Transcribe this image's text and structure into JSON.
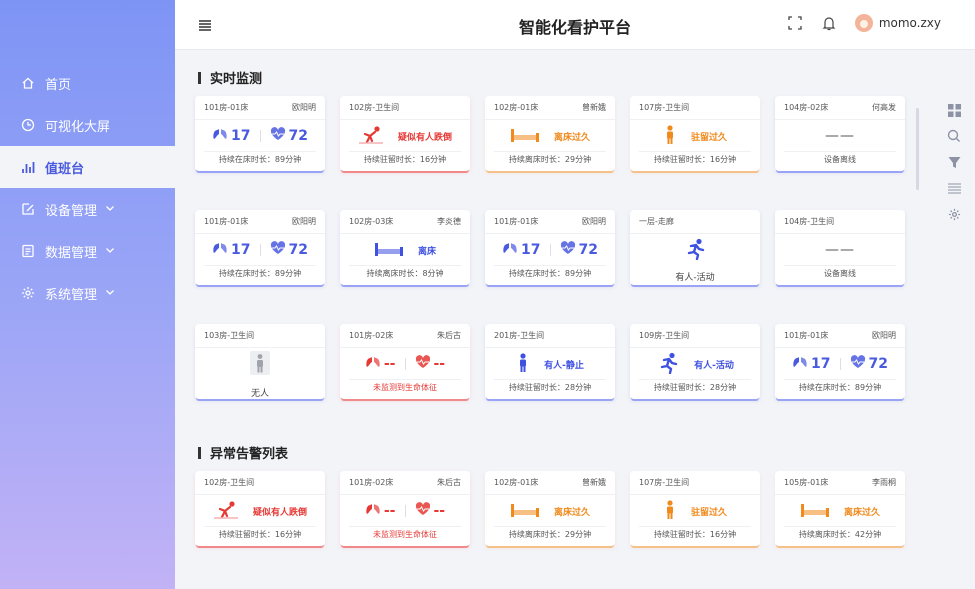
{
  "app": {
    "title": "智能化看护平台"
  },
  "user": {
    "name": "momo.zxy"
  },
  "sidebar": {
    "items": [
      {
        "label": "首页",
        "icon": "home-icon"
      },
      {
        "label": "可视化大屏",
        "icon": "clock-icon"
      },
      {
        "label": "值班台",
        "icon": "bar-chart-icon",
        "active": true
      },
      {
        "label": "设备管理",
        "icon": "edit-icon",
        "has_children": true
      },
      {
        "label": "数据管理",
        "icon": "document-icon",
        "has_children": true
      },
      {
        "label": "系统管理",
        "icon": "gear-icon",
        "has_children": true
      }
    ]
  },
  "sections": {
    "realtime": "实时监测",
    "alerts": "异常告警列表"
  },
  "colors": {
    "accent": "#4a5adf",
    "alert_red": "#e53935",
    "warn_orange": "#f08a1c",
    "sidebar_top": "#7e94f5",
    "sidebar_bottom": "#c2b2f6"
  },
  "realtime_cards": [
    {
      "location": "101房-01床",
      "person": "欧阳明",
      "type": "vitals",
      "lung": "17",
      "heart": "72",
      "footer": "持续在床时长：89分钟",
      "accent": "blue"
    },
    {
      "location": "102房-卫生间",
      "person": "",
      "type": "state",
      "icon": "fall-icon",
      "status": "疑似有人跌倒",
      "tone": "red",
      "footer": "持续驻留时长：16分钟",
      "accent": "red"
    },
    {
      "location": "102房-01床",
      "person": "曾新娥",
      "type": "state",
      "icon": "bed-icon",
      "status": "离床过久",
      "tone": "orange",
      "footer": "持续离床时长：29分钟",
      "accent": "orange"
    },
    {
      "location": "107房-卫生间",
      "person": "",
      "type": "state",
      "icon": "person-standing-icon",
      "status": "驻留过久",
      "tone": "orange",
      "footer": "持续驻留时长：16分钟",
      "accent": "orange"
    },
    {
      "location": "104房-02床",
      "person": "何高发",
      "type": "dash",
      "status": "——",
      "footer": "设备离线",
      "accent": "blue"
    },
    {
      "location": "101房-01床",
      "person": "欧阳明",
      "type": "vitals",
      "lung": "17",
      "heart": "72",
      "footer": "持续在床时长：89分钟",
      "accent": "blue"
    },
    {
      "location": "102房-03床",
      "person": "李炎德",
      "type": "state",
      "icon": "bed-icon",
      "status": "离床",
      "tone": "blue",
      "footer": "持续离床时长：8分钟",
      "accent": "blue"
    },
    {
      "location": "101房-01床",
      "person": "欧阳明",
      "type": "vitals",
      "lung": "17",
      "heart": "72",
      "footer": "持续在床时长：89分钟",
      "accent": "blue"
    },
    {
      "location": "一层-走廊",
      "person": "",
      "type": "big",
      "icon": "running-icon",
      "status": "有人-活动",
      "accent": "blue"
    },
    {
      "location": "104房-卫生间",
      "person": "",
      "type": "dash",
      "status": "——",
      "footer": "设备离线",
      "accent": "blue"
    },
    {
      "location": "103房-卫生间",
      "person": "",
      "type": "big",
      "icon": "person-box-icon",
      "status": "无人",
      "accent": "blue"
    },
    {
      "location": "101房-02床",
      "person": "朱后古",
      "type": "vitals-none",
      "lung": "--",
      "heart": "--",
      "footer": "未监测到生命体征",
      "alert": true,
      "accent": "red"
    },
    {
      "location": "201房-卫生间",
      "person": "",
      "type": "state",
      "icon": "person-standing-icon",
      "status": "有人-静止",
      "tone": "blue",
      "footer": "持续驻留时长：28分钟",
      "accent": "blue"
    },
    {
      "location": "109房-卫生间",
      "person": "",
      "type": "state",
      "icon": "running-icon",
      "status": "有人-活动",
      "tone": "blue",
      "footer": "持续驻留时长：28分钟",
      "accent": "blue"
    },
    {
      "location": "101房-01床",
      "person": "欧阳明",
      "type": "vitals",
      "lung": "17",
      "heart": "72",
      "footer": "持续在床时长：89分钟",
      "accent": "blue"
    }
  ],
  "alert_cards": [
    {
      "location": "102房-卫生间",
      "person": "",
      "type": "state",
      "icon": "fall-icon",
      "status": "疑似有人跌倒",
      "tone": "red",
      "footer": "持续驻留时长：16分钟",
      "accent": "red"
    },
    {
      "location": "101房-02床",
      "person": "朱后古",
      "type": "vitals-none",
      "lung": "--",
      "heart": "--",
      "footer": "未监测到生命体征",
      "alert": true,
      "accent": "red"
    },
    {
      "location": "102房-01床",
      "person": "曾新娥",
      "type": "state",
      "icon": "bed-icon",
      "status": "离床过久",
      "tone": "orange",
      "footer": "持续离床时长：29分钟",
      "accent": "orange"
    },
    {
      "location": "107房-卫生间",
      "person": "",
      "type": "state",
      "icon": "person-standing-icon",
      "status": "驻留过久",
      "tone": "orange",
      "footer": "持续驻留时长：16分钟",
      "accent": "orange"
    },
    {
      "location": "105房-01床",
      "person": "李雨桐",
      "type": "state",
      "icon": "bed-icon",
      "status": "离床过久",
      "tone": "orange",
      "footer": "持续离床时长：42分钟",
      "accent": "orange"
    }
  ],
  "right_toolbar": [
    "grid-icon",
    "search-icon",
    "filter-icon",
    "list-icon",
    "gear-icon"
  ]
}
